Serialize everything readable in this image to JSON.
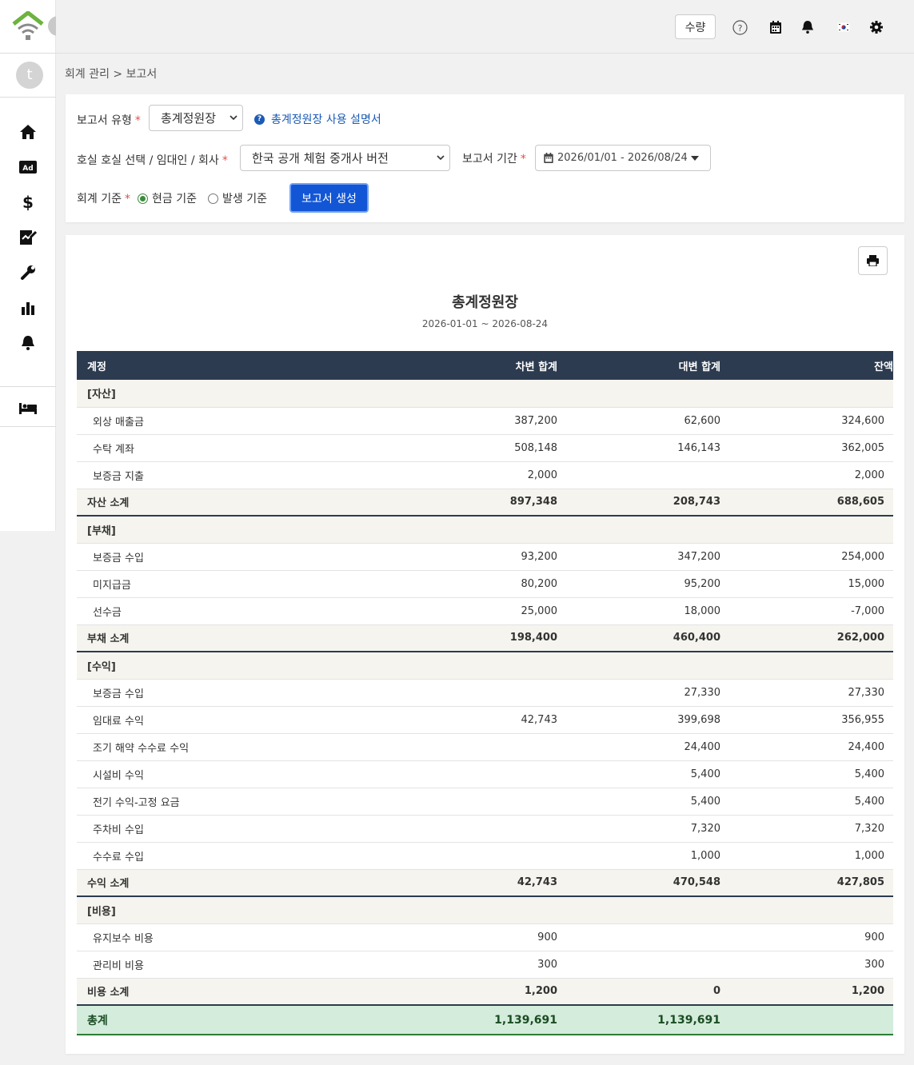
{
  "topbar": {
    "qty_button": "수량"
  },
  "user": {
    "initial": "t"
  },
  "breadcrumb": "회계 관리 > 보고서",
  "filters": {
    "report_type_label": "보고서 유형",
    "report_type_value": "총계정원장",
    "help_link": "총계정원장 사용 설명서",
    "target_label": "호실 호실 선택 / 임대인 / 회사",
    "target_value": "한국 공개 체험 중개사 버전",
    "period_label": "보고서 기간",
    "period_value": "2026/01/01 - 2026/08/24",
    "basis_label": "회계 기준",
    "basis_cash": "현금 기준",
    "basis_accrual": "발생 기준",
    "basis_selected": "cash",
    "generate_button": "보고서 생성",
    "required_mark": "*"
  },
  "report": {
    "title": "총계정원장",
    "period": "2026-01-01 ~ 2026-08-24",
    "columns": [
      "계정",
      "차변 합계",
      "대변 합계",
      "잔액"
    ],
    "sections": [
      {
        "category": "[자산]",
        "rows": [
          {
            "account": "외상 매출금",
            "debit": "387,200",
            "credit": "62,600",
            "balance": "324,600"
          },
          {
            "account": "수탁 계좌",
            "debit": "508,148",
            "credit": "146,143",
            "balance": "362,005"
          },
          {
            "account": "보증금 지출",
            "debit": "2,000",
            "credit": "",
            "balance": "2,000"
          }
        ],
        "subtotal": {
          "label": "자산 소계",
          "debit": "897,348",
          "credit": "208,743",
          "balance": "688,605"
        }
      },
      {
        "category": "[부채]",
        "rows": [
          {
            "account": "보증금 수입",
            "debit": "93,200",
            "credit": "347,200",
            "balance": "254,000"
          },
          {
            "account": "미지급금",
            "debit": "80,200",
            "credit": "95,200",
            "balance": "15,000"
          },
          {
            "account": "선수금",
            "debit": "25,000",
            "credit": "18,000",
            "balance": "-7,000"
          }
        ],
        "subtotal": {
          "label": "부채 소계",
          "debit": "198,400",
          "credit": "460,400",
          "balance": "262,000"
        }
      },
      {
        "category": "[수익]",
        "rows": [
          {
            "account": "보증금 수입",
            "debit": "",
            "credit": "27,330",
            "balance": "27,330"
          },
          {
            "account": "임대료 수익",
            "debit": "42,743",
            "credit": "399,698",
            "balance": "356,955"
          },
          {
            "account": "조기 해약 수수료 수익",
            "debit": "",
            "credit": "24,400",
            "balance": "24,400"
          },
          {
            "account": "시설비 수익",
            "debit": "",
            "credit": "5,400",
            "balance": "5,400"
          },
          {
            "account": "전기 수익-고정 요금",
            "debit": "",
            "credit": "5,400",
            "balance": "5,400"
          },
          {
            "account": "주차비 수입",
            "debit": "",
            "credit": "7,320",
            "balance": "7,320"
          },
          {
            "account": "수수료 수입",
            "debit": "",
            "credit": "1,000",
            "balance": "1,000"
          }
        ],
        "subtotal": {
          "label": "수익 소계",
          "debit": "42,743",
          "credit": "470,548",
          "balance": "427,805"
        }
      },
      {
        "category": "[비용]",
        "rows": [
          {
            "account": "유지보수 비용",
            "debit": "900",
            "credit": "",
            "balance": "900"
          },
          {
            "account": "관리비 비용",
            "debit": "300",
            "credit": "",
            "balance": "300"
          }
        ],
        "subtotal": {
          "label": "비용 소계",
          "debit": "1,200",
          "credit": "0",
          "balance": "1,200"
        }
      }
    ],
    "total": {
      "label": "총계",
      "debit": "1,139,691",
      "credit": "1,139,691",
      "balance": ""
    }
  },
  "colors": {
    "header_bg": "#2c3b4f",
    "category_bg": "#f5f4ee",
    "total_bg": "#d4ecdb",
    "primary_button": "#1256d6",
    "negative": "#c62828",
    "logo_green": "#6cb33f"
  },
  "icons": {
    "sidebar": [
      "home-icon",
      "ad-icon",
      "dollar-icon",
      "contract-icon",
      "wrench-icon",
      "bar-chart-icon",
      "bell-icon",
      "bed-icon"
    ],
    "topbar": [
      "help-icon",
      "calendar-icon",
      "bell-icon",
      "korea-flag-icon",
      "gear-icon"
    ]
  }
}
